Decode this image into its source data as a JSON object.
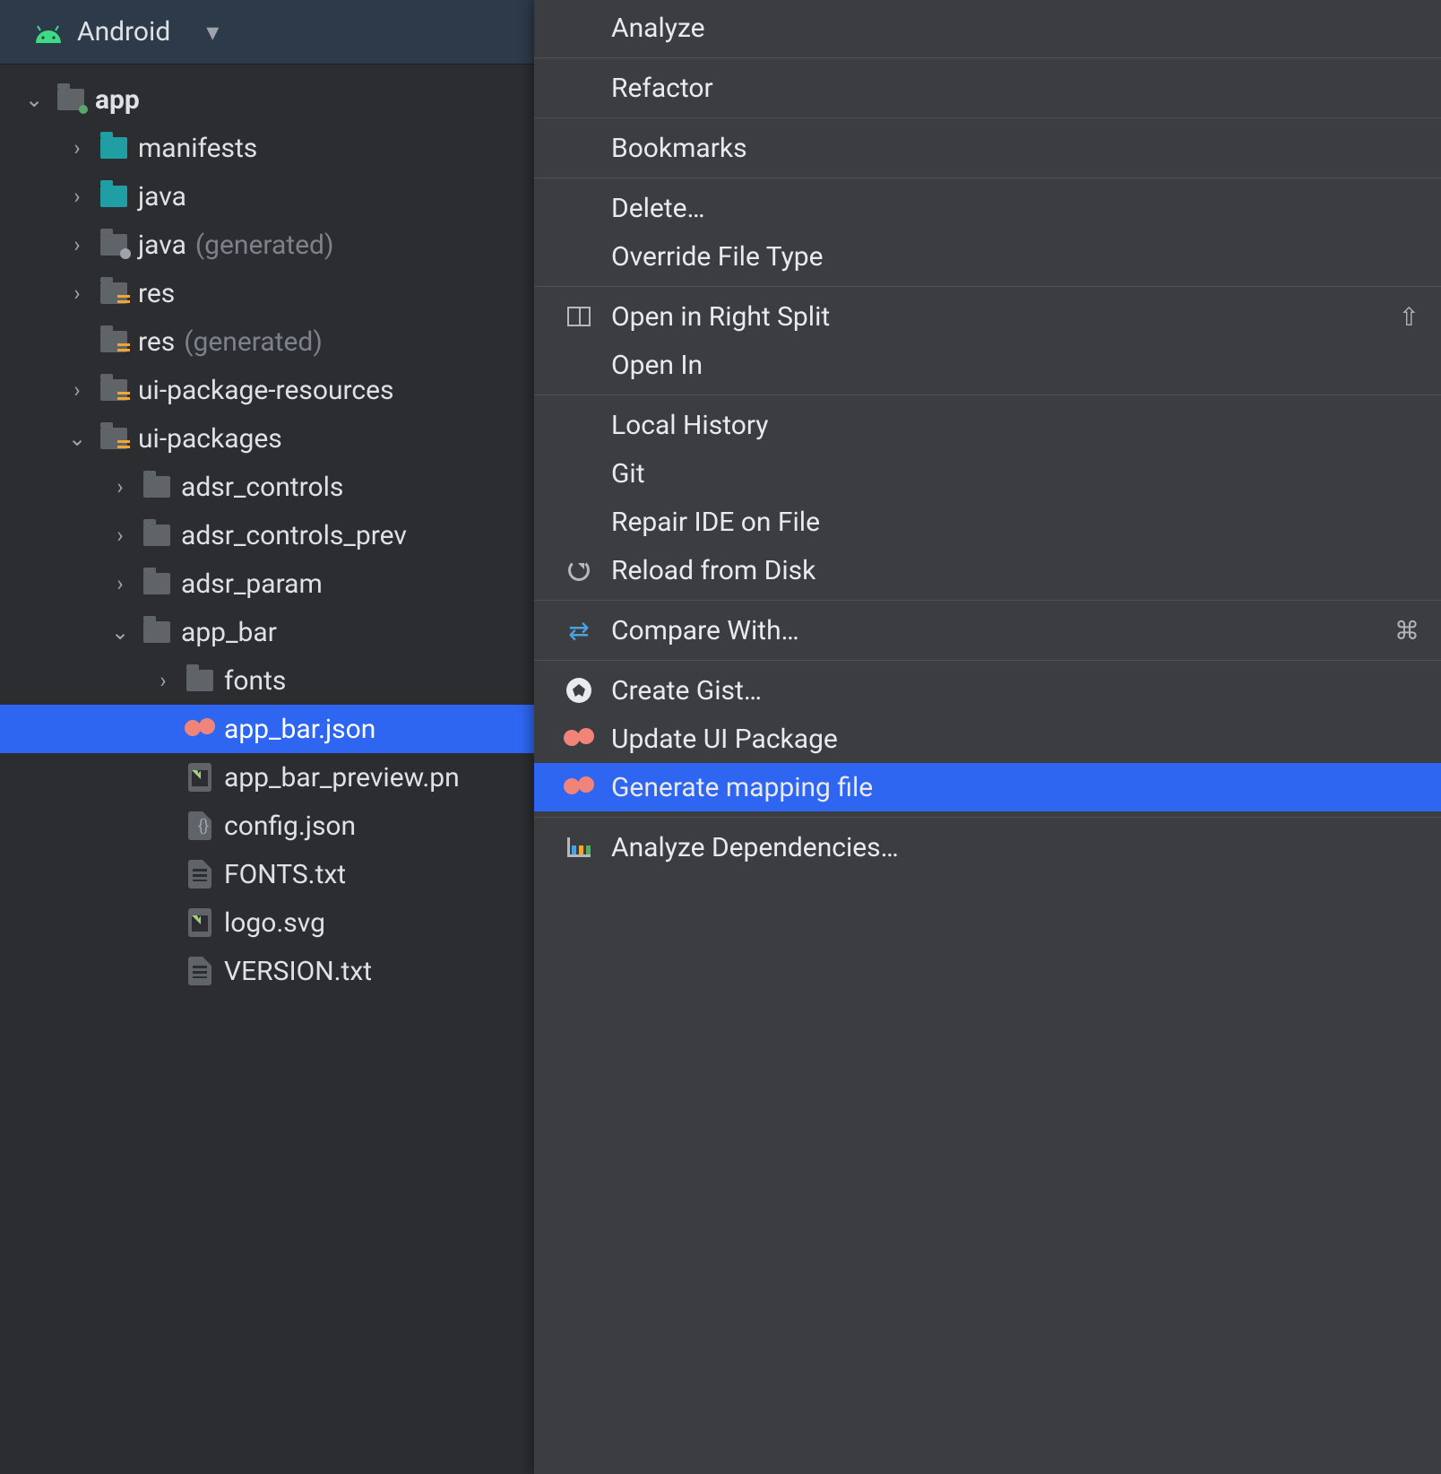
{
  "header": {
    "view_label": "Android"
  },
  "tree": {
    "root": {
      "label": "app"
    },
    "items": [
      {
        "label": "manifests",
        "muted": ""
      },
      {
        "label": "java",
        "muted": ""
      },
      {
        "label": "java",
        "muted": " (generated)"
      },
      {
        "label": "res",
        "muted": ""
      },
      {
        "label": "res",
        "muted": " (generated)"
      },
      {
        "label": "ui-package-resources",
        "muted": ""
      },
      {
        "label": "ui-packages",
        "muted": ""
      }
    ],
    "pkg": [
      {
        "label": "adsr_controls"
      },
      {
        "label": "adsr_controls_prev"
      },
      {
        "label": "adsr_param"
      },
      {
        "label": "app_bar"
      }
    ],
    "appbar": {
      "fonts": "fonts",
      "json": "app_bar.json",
      "preview": "app_bar_preview.pn",
      "config": "config.json",
      "fontstxt": "FONTS.txt",
      "logo": "logo.svg",
      "version": "VERSION.txt"
    }
  },
  "ctx": {
    "analyze": "Analyze",
    "refactor": "Refactor",
    "bookmarks": "Bookmarks",
    "delete": "Delete…",
    "override": "Override File Type",
    "open_split": "Open in Right Split",
    "open_split_key": "⇧",
    "open_in": "Open In",
    "local_history": "Local History",
    "git": "Git",
    "repair": "Repair IDE on File",
    "reload": "Reload from Disk",
    "compare": "Compare With…",
    "compare_key": "⌘",
    "gist": "Create Gist…",
    "update_pkg": "Update UI Package",
    "gen_mapping": "Generate mapping file",
    "analyze_deps": "Analyze Dependencies…"
  }
}
